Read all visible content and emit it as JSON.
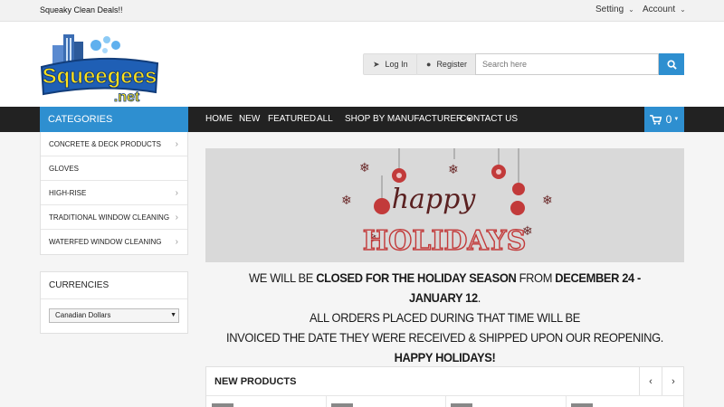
{
  "topbar": {
    "tagline": "Squeaky Clean Deals!!",
    "setting_label": "Setting",
    "account_label": "Account"
  },
  "header": {
    "logo_text": "Squeegees",
    "logo_subtext": ".net",
    "login_label": "Log In",
    "register_label": "Register",
    "search_placeholder": "Search here"
  },
  "nav": {
    "categories_label": "CATEGORIES",
    "items": [
      "HOME",
      "NEW",
      "FEATURED",
      "ALL",
      "SHOP BY MANUFACTURER",
      "CONTACT US"
    ],
    "cart_count": "0"
  },
  "sidebar": {
    "categories": [
      "CONCRETE & DECK PRODUCTS",
      "GLOVES",
      "HIGH-RISE",
      "TRADITIONAL WINDOW CLEANING",
      "WATERFED WINDOW CLEANING"
    ],
    "currencies_label": "CURRENCIES",
    "currency_selected": "Canadian Dollars"
  },
  "banner": {
    "word1": "happy",
    "word2": "HOLIDAYS"
  },
  "notice": {
    "l1a": "WE WILL BE ",
    "l1b": "CLOSED FOR THE HOLIDAY SEASON",
    "l1c": " FROM ",
    "l1d": "DECEMBER 24 - JANUARY 12",
    "l1e": ".",
    "l2": "ALL ORDERS PLACED DURING THAT TIME WILL BE",
    "l3": "INVOICED THE DATE THEY WERE RECEIVED & SHIPPED UPON OUR REOPENING.",
    "l4": "HAPPY HOLIDAYS!"
  },
  "new_products": {
    "heading": "NEW PRODUCTS"
  },
  "colors": {
    "accent": "#2e8fd0",
    "nav_bg": "#222222",
    "ornament_red": "#c23a3a"
  }
}
